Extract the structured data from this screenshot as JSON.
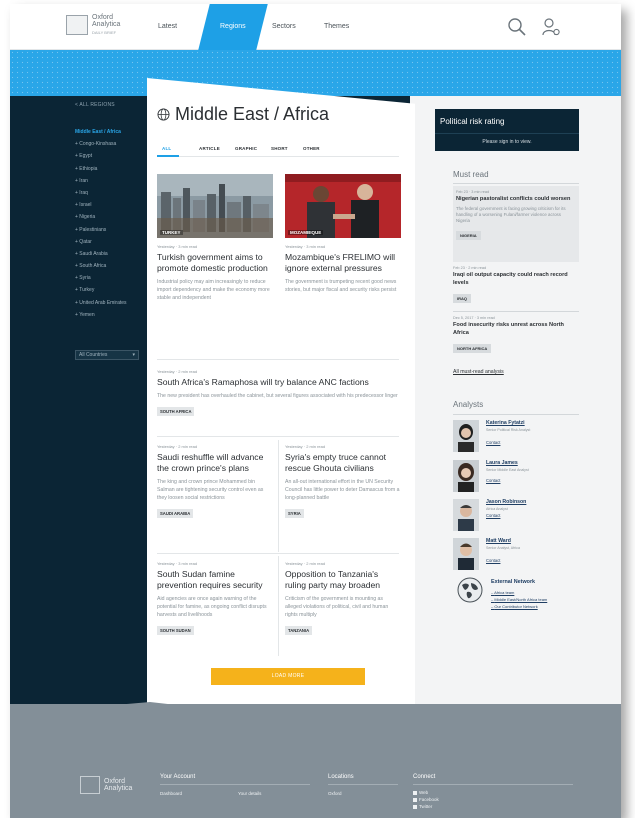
{
  "header": {
    "logo_line1": "Oxford",
    "logo_line2": "Analytica",
    "logo_sub": "DAILY BRIEF",
    "nav": [
      "Latest",
      "Regions",
      "Sectors",
      "Themes"
    ],
    "active_nav": "Regions",
    "icons": [
      "search-icon",
      "user-settings-icon"
    ]
  },
  "sidebar": {
    "back": "< ALL REGIONS",
    "items": [
      "Middle East / Africa",
      "+ Congo-Kinshasa",
      "+ Egypt",
      "+ Ethiopia",
      "+ Iran",
      "+ Iraq",
      "+ Israel",
      "+ Nigeria",
      "+ Palestinians",
      "+ Qatar",
      "+ Saudi Arabia",
      "+ South Africa",
      "+ Syria",
      "+ Turkey",
      "+ United Arab Emirates",
      "+ Yemen"
    ],
    "select": "All Countries"
  },
  "main": {
    "title": "Middle East / Africa",
    "tabs": [
      "ALL",
      "ARTICLE",
      "GRAPHIC",
      "SHORT",
      "OTHER"
    ],
    "active_tab": "ALL",
    "featured": [
      {
        "img_label": "TURKEY",
        "meta": "Yesterday · 3 min read",
        "headline": "Turkish government aims to promote domestic production",
        "summary": "Industrial policy may aim increasingly to reduce import dependency and make the economy more stable and independent"
      },
      {
        "img_label": "MOZAMBIQUE",
        "meta": "Yesterday · 3 min read",
        "headline": "Mozambique's FRELIMO will ignore external pressures",
        "summary": "The government is trumpeting recent good news stories, but major fiscal and security risks persist"
      }
    ],
    "wide": {
      "meta": "Yesterday · 2 min read",
      "headline": "South Africa's Ramaphosa will try balance ANC factions",
      "summary": "The new president has overhauled the cabinet, but several figures associated with his predecessor linger",
      "tag": "SOUTH AFRICA"
    },
    "grid": [
      {
        "meta": "Yesterday · 2 min read",
        "headline": "Saudi reshuffle will advance the crown prince's plans",
        "summary": "The king and crown prince Mohammed bin Salman are tightening security control even as they loosen social restrictions",
        "tag": "SAUDI ARABIA"
      },
      {
        "meta": "Yesterday · 2 min read",
        "headline": "Syria's empty truce cannot rescue Ghouta civilians",
        "summary": "An all-out international effort in the UN Security Council has little power to deter Damascus from a long-planned battle",
        "tag": "SYRIA"
      },
      {
        "meta": "Yesterday · 3 min read",
        "headline": "South Sudan famine prevention requires security",
        "summary": "Aid agencies are once again warning of the potential for famine, as ongoing conflict disrupts harvests and livelihoods",
        "tag": "SOUTH SUDAN"
      },
      {
        "meta": "Yesterday · 2 min read",
        "headline": "Opposition to Tanzania's ruling party may broaden",
        "summary": "Criticism of the government is mounting as alleged violations of political, civil and human rights multiply",
        "tag": "TANZANIA"
      }
    ],
    "load_more": "LOAD MORE"
  },
  "right": {
    "risk_title": "Political risk rating",
    "risk_sub": "Please sign in to view.",
    "must_read_title": "Must read",
    "must_read": [
      {
        "meta": "Feb 23 · 3 min read",
        "headline": "Nigerian pastoralist conflicts could worsen",
        "summary": "The federal government is facing growing criticism for its handling of a worsening Fulani/farmer violence across Nigeria",
        "tag": "NIGERIA"
      },
      {
        "meta": "Feb 23 · 2 min read",
        "headline": "Iraqi oil output capacity could reach record levels",
        "summary": "",
        "tag": "IRAQ"
      },
      {
        "meta": "Dec 5, 2017 · 3 min read",
        "headline": "Food insecurity risks unrest across North Africa",
        "summary": "",
        "tag": "NORTH AFRICA"
      }
    ],
    "all_must_read": "All must-read analysis",
    "analysts_title": "Analysts",
    "analysts": [
      {
        "name": "Katerina Fytatzi",
        "role": "Senior Political Risk Analyst",
        "contact": "Contact"
      },
      {
        "name": "Laura James",
        "role": "Senior Middle East Analyst",
        "contact": "Contact"
      },
      {
        "name": "Jason Robinson",
        "role": "Africa Analyst",
        "contact": "Contact"
      },
      {
        "name": "Matt Ward",
        "role": "Senior Analyst, Africa",
        "contact": "Contact"
      }
    ],
    "external_title": "External Network",
    "external": [
      "Africa team",
      "Middle East/North Africa team",
      "Our Contributor Network"
    ]
  },
  "footer": {
    "logo_line1": "Oxford",
    "logo_line2": "Analytica",
    "your_account": "Your Account",
    "account_links": [
      "Dashboard",
      "Your details"
    ],
    "locations": "Locations",
    "location_links": [
      "Oxford"
    ],
    "connect": "Connect",
    "connect_links": [
      "Web",
      "Facebook",
      "Twitter"
    ]
  },
  "colors": {
    "brand_blue": "#1ea0e6",
    "dark_navy": "#0b2535",
    "load_more": "#f5b21b",
    "footer": "#838f98"
  }
}
